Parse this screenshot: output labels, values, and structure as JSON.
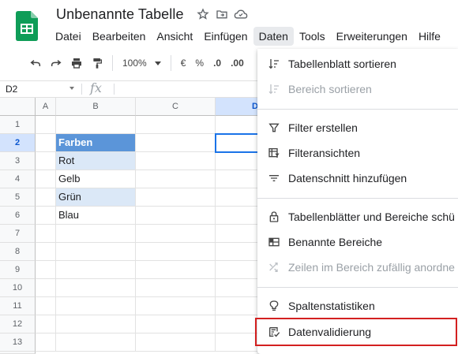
{
  "header": {
    "doc_title": "Unbenannte Tabelle",
    "icons": [
      "star-icon",
      "move-folder-icon",
      "cloud-status-icon"
    ]
  },
  "menubar": {
    "items": [
      "Datei",
      "Bearbeiten",
      "Ansicht",
      "Einfügen",
      "Daten",
      "Tools",
      "Erweiterungen",
      "Hilfe"
    ],
    "active": "Daten"
  },
  "toolbar": {
    "zoom": "100%",
    "currency": "€",
    "percent": "%",
    "decimal_decrease": ".0",
    "decimal_increase": ".00"
  },
  "formula_bar": {
    "cell_ref": "D2",
    "fx": "fx",
    "value": ""
  },
  "sheet": {
    "columns": [
      "A",
      "B",
      "C",
      "D"
    ],
    "rows": [
      "1",
      "2",
      "3",
      "4",
      "5",
      "6",
      "7",
      "8",
      "9",
      "10",
      "11",
      "12",
      "13",
      "14"
    ],
    "selected_cell": "D2",
    "cells": {
      "B2": "Farben",
      "B3": "Rot",
      "B4": "Gelb",
      "B5": "Grün",
      "B6": "Blau"
    }
  },
  "data_menu": {
    "sections": [
      [
        {
          "label": "Tabellenblatt sortieren",
          "icon": "sort-icon",
          "enabled": true
        },
        {
          "label": "Bereich sortieren",
          "icon": "sort-range-icon",
          "enabled": false
        }
      ],
      [
        {
          "label": "Filter erstellen",
          "icon": "filter-icon",
          "enabled": true
        },
        {
          "label": "Filteransichten",
          "icon": "filter-views-icon",
          "enabled": true
        },
        {
          "label": "Datenschnitt hinzufügen",
          "icon": "slicer-icon",
          "enabled": true
        }
      ],
      [
        {
          "label": "Tabellenblätter und Bereiche schü",
          "icon": "lock-icon",
          "enabled": true
        },
        {
          "label": "Benannte Bereiche",
          "icon": "named-ranges-icon",
          "enabled": true
        },
        {
          "label": "Zeilen im Bereich zufällig anordne",
          "icon": "shuffle-icon",
          "enabled": false
        }
      ],
      [
        {
          "label": "Spaltenstatistiken",
          "icon": "lightbulb-icon",
          "enabled": true
        },
        {
          "label": "Datenvalidierung",
          "icon": "data-validation-icon",
          "enabled": true,
          "highlighted": true
        }
      ]
    ]
  },
  "colors": {
    "header_fill": "#5b95d9",
    "band_fill": "#dbe8f7",
    "highlight_border": "#d32020",
    "selection": "#1a73e8",
    "logo": "#0f9d58"
  }
}
